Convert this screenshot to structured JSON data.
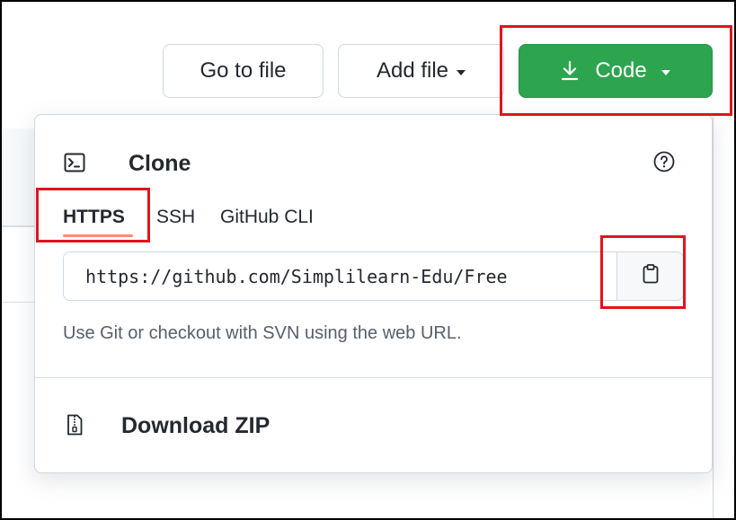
{
  "header_buttons": {
    "go_to_file": "Go to file",
    "add_file": "Add file",
    "code": "Code"
  },
  "clone_panel": {
    "title": "Clone",
    "tabs": [
      {
        "label": "HTTPS",
        "selected": true
      },
      {
        "label": "SSH",
        "selected": false
      },
      {
        "label": "GitHub CLI",
        "selected": false
      }
    ],
    "url_value": "https://github.com/Simplilearn-Edu/Free",
    "hint": "Use Git or checkout with SVN using the web URL.",
    "download_zip": "Download ZIP"
  },
  "colors": {
    "code_button": "#2da44e",
    "highlight_boxes": "#e0141e",
    "selected_tab_underline": "#fd8c73"
  },
  "icons": {
    "code_button": "download-icon",
    "clone": "terminal-icon",
    "help": "question-icon",
    "copy": "clipboard-icon",
    "download_zip": "file-zip-icon"
  }
}
